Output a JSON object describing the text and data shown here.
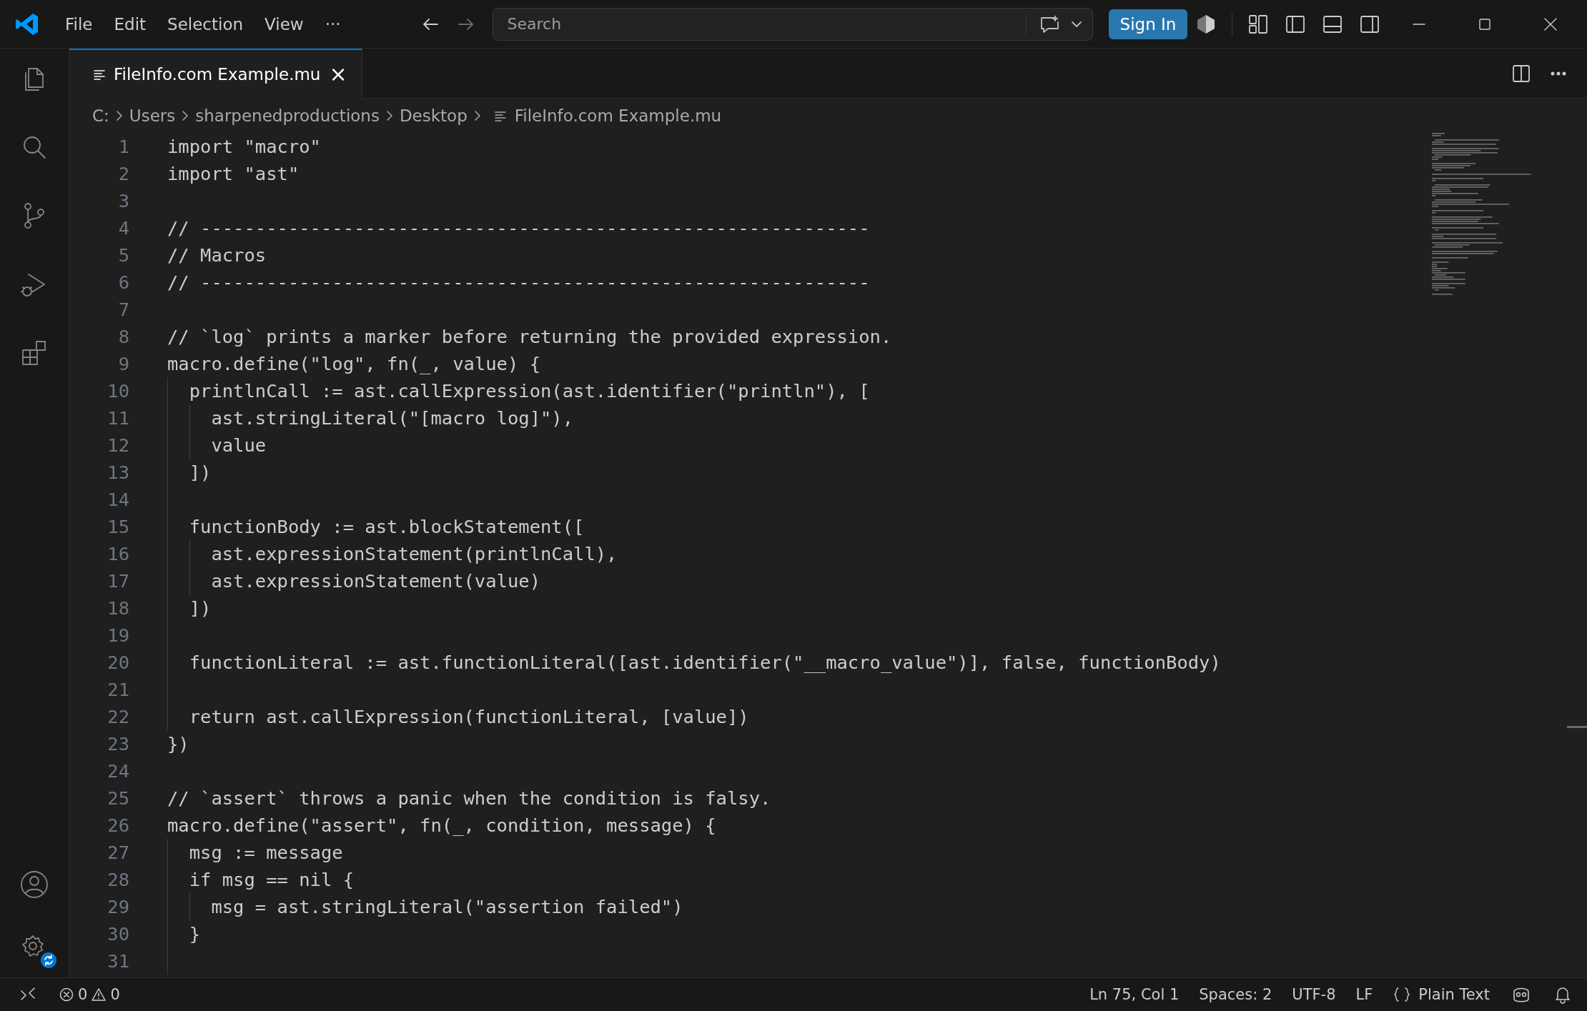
{
  "menu": [
    "File",
    "Edit",
    "Selection",
    "View",
    "···"
  ],
  "search": {
    "placeholder": "Search"
  },
  "sign_in": "Sign In",
  "tabs": [
    {
      "label": "FileInfo.com Example.mu",
      "selected": true,
      "close": "×"
    }
  ],
  "breadcrumb": [
    "C:",
    "Users",
    "sharpenedproductions",
    "Desktop",
    "FileInfo.com Example.mu"
  ],
  "code": [
    {
      "number": "1",
      "text": "import \"macro\""
    },
    {
      "number": "2",
      "text": "import \"ast\""
    },
    {
      "number": "3"
    },
    {
      "number": "4",
      "text": "// -------------------------------------------------------------"
    },
    {
      "number": "5",
      "text": "// Macros"
    },
    {
      "number": "6",
      "text": "// -------------------------------------------------------------"
    },
    {
      "number": "7"
    },
    {
      "number": "8",
      "text": "// `log` prints a marker before returning the provided expression."
    },
    {
      "number": "9",
      "text": "macro.define(\"log\", fn(_, value) {"
    },
    {
      "number": "10",
      "text": "  printlnCall := ast.callExpression(ast.identifier(\"println\"), ["
    },
    {
      "number": "11",
      "text": "    ast.stringLiteral(\"[macro log]\"),"
    },
    {
      "number": "12",
      "text": "    value"
    },
    {
      "number": "13",
      "text": "  ])"
    },
    {
      "number": "14"
    },
    {
      "number": "15",
      "text": "  functionBody := ast.blockStatement(["
    },
    {
      "number": "16",
      "text": "    ast.expressionStatement(printlnCall),"
    },
    {
      "number": "17",
      "text": "    ast.expressionStatement(value)"
    },
    {
      "number": "18",
      "text": "  ])"
    },
    {
      "number": "19"
    },
    {
      "number": "20",
      "text": "  functionLiteral := ast.functionLiteral([ast.identifier(\"__macro_value\")], false, functionBody)"
    },
    {
      "number": "21"
    },
    {
      "number": "22",
      "text": "  return ast.callExpression(functionLiteral, [value])"
    },
    {
      "number": "23",
      "text": "})"
    },
    {
      "number": "24"
    },
    {
      "number": "25",
      "text": "// `assert` throws a panic when the condition is falsy."
    },
    {
      "number": "26",
      "text": "macro.define(\"assert\", fn(_, condition, message) {"
    },
    {
      "number": "27",
      "text": "  msg := message"
    },
    {
      "number": "28",
      "text": "  if msg == nil {"
    },
    {
      "number": "29",
      "text": "    msg = ast.stringLiteral(\"assertion failed\")"
    },
    {
      "number": "30",
      "text": "  }"
    },
    {
      "number": "31"
    }
  ],
  "status_bar": {
    "errors": "0",
    "warnings": "0",
    "position": "Ln 75, Col 1",
    "indent": "Spaces: 2",
    "encoding": "UTF-8",
    "eol": "LF",
    "language": "Plain Text"
  }
}
